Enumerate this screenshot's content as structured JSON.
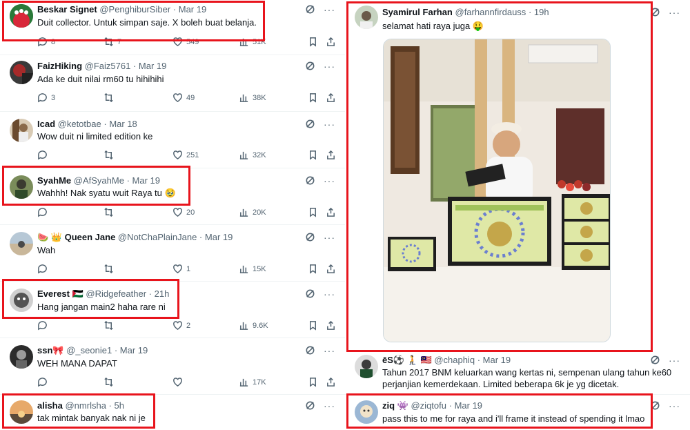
{
  "left_tweets": [
    {
      "name": "Beskar Signet",
      "handle": "@PenghiburSiber",
      "date": "Mar 19",
      "text": "Duit collector. Untuk simpan saje. X boleh buat belanja.",
      "replies": "8",
      "reposts": "7",
      "likes": "549",
      "views": "51K"
    },
    {
      "name": "FaizHiking",
      "handle": "@Faiz5761",
      "date": "Mar 19",
      "text": "Ada ke duit nilai rm60 tu hihihihi",
      "replies": "3",
      "reposts": "",
      "likes": "49",
      "views": "38K"
    },
    {
      "name": "Icad",
      "handle": "@ketotbae",
      "date": "Mar 18",
      "text": "Wow duit ni limited edition ke",
      "replies": "",
      "reposts": "",
      "likes": "251",
      "views": "32K"
    },
    {
      "name": "SyahMe",
      "handle": "@AfSyahMe",
      "date": "Mar 19",
      "text": "Wahhh! Nak syatu wuit Raya tu 🥹",
      "replies": "",
      "reposts": "",
      "likes": "20",
      "views": "20K"
    },
    {
      "name": "🍉 👑 Queen Jane",
      "handle": "@NotChaPlainJane",
      "date": "Mar 19",
      "text": "Wah",
      "replies": "",
      "reposts": "",
      "likes": "1",
      "views": "15K"
    },
    {
      "name": "Everest 🇵🇸",
      "handle": "@Ridgefeather",
      "date": "21h",
      "text": "Hang jangan main2 haha rare ni",
      "replies": "",
      "reposts": "",
      "likes": "2",
      "views": "9.6K"
    },
    {
      "name": "ssn🎀",
      "handle": "@_seonie1",
      "date": "Mar 19",
      "text": "WEH MANA DAPAT",
      "replies": "",
      "reposts": "",
      "likes": "",
      "views": "17K"
    },
    {
      "name": "alisha",
      "handle": "@nmrlsha",
      "date": "5h",
      "text": "tak mintak banyak nak ni je",
      "replies": "",
      "reposts": "",
      "likes": "",
      "views": ""
    }
  ],
  "main_tweet": {
    "name": "Syamirul Farhan",
    "handle": "@farhannfirdauss",
    "date": "19h",
    "text": "selamat hati raya juga 🤑"
  },
  "right_tweets": [
    {
      "name": "ēS⚽ 🧎 🇲🇾",
      "handle": "@chaphiq",
      "date": "Mar 19",
      "text1": "Tahun 2017 BNM keluarkan wang kertas ni, sempenan ulang tahun ke60",
      "text2": "perjanjian kemerdekaan. Limited beberapa 6k je yg dicetak."
    },
    {
      "name": "ziq 👾",
      "handle": "@ziqtofu",
      "date": "Mar 19",
      "text1": "pass this to me for raya and i'll frame it instead of spending it lmao",
      "text2": ""
    }
  ],
  "separator": "·",
  "more_glyph": "···",
  "colors": {
    "highlight": "#e8141c",
    "secondary_text": "#536471",
    "divider": "#eff3f4"
  }
}
